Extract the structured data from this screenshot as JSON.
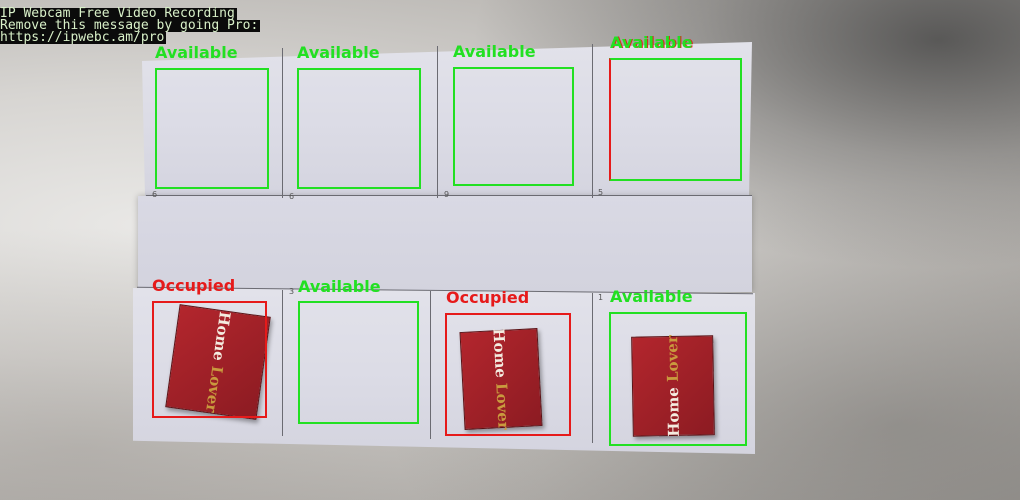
{
  "overlay": {
    "line1": "IP Webcam Free Video Recording",
    "line2": "Remove this message by going Pro:",
    "line3": "https://ipwebc.am/pro"
  },
  "slots": {
    "s1": {
      "status": "Available"
    },
    "s2": {
      "status": "Available"
    },
    "s3": {
      "status": "Available"
    },
    "s4": {
      "status": "Available"
    },
    "s5": {
      "status": "Occupied"
    },
    "s6": {
      "status": "Available"
    },
    "s7": {
      "status": "Occupied"
    },
    "s8": {
      "status": "Available"
    }
  },
  "cell_numbers": {
    "c1": "6",
    "c2": "6",
    "c3": "9",
    "c4": "5",
    "c5": "3",
    "c6": "1"
  },
  "box_brand": {
    "word1": "Home",
    "word2": "Lover"
  },
  "colors": {
    "available": "#22e022",
    "occupied": "#e61a1a"
  }
}
